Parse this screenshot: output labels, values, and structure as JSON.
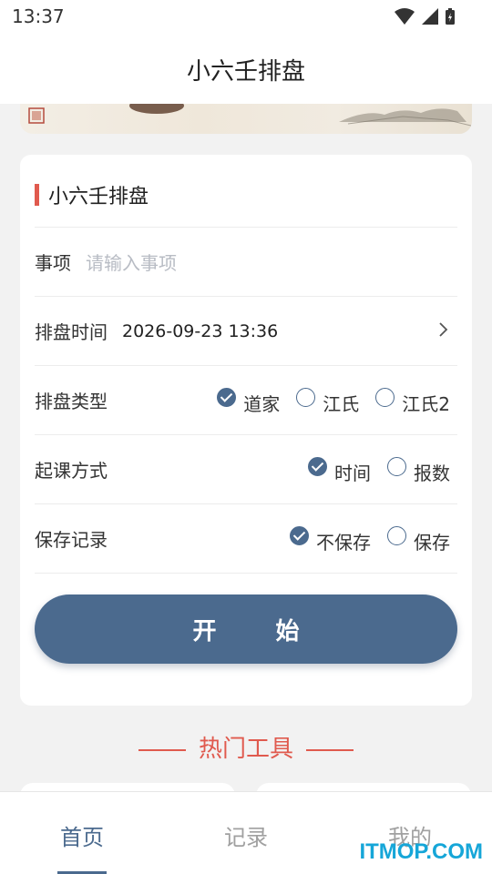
{
  "status_bar": {
    "time": "13:37"
  },
  "header": {
    "title": "小六壬排盘"
  },
  "form": {
    "section_title": "小六壬排盘",
    "matter": {
      "label": "事项",
      "placeholder": "请输入事项"
    },
    "time": {
      "label": "排盘时间",
      "value": "2026-09-23 13:36"
    },
    "chart_type": {
      "label": "排盘类型",
      "options": [
        {
          "label": "道家",
          "checked": true
        },
        {
          "label": "江氏",
          "checked": false
        },
        {
          "label": "江氏2",
          "checked": false
        }
      ]
    },
    "method": {
      "label": "起课方式",
      "options": [
        {
          "label": "时间",
          "checked": true
        },
        {
          "label": "报数",
          "checked": false
        }
      ]
    },
    "save": {
      "label": "保存记录",
      "options": [
        {
          "label": "不保存",
          "checked": true
        },
        {
          "label": "保存",
          "checked": false
        }
      ]
    },
    "start_button": "开 始"
  },
  "hot_tools": {
    "title": "热门工具"
  },
  "tabbar": {
    "tabs": [
      {
        "label": "首页",
        "active": true
      },
      {
        "label": "记录",
        "active": false
      },
      {
        "label": "我的",
        "active": false
      }
    ]
  },
  "watermark": "ITMOP.COM",
  "colors": {
    "accent": "#4b6a8e",
    "brand_red": "#e05a4e",
    "watermark": "#16a6d8"
  }
}
